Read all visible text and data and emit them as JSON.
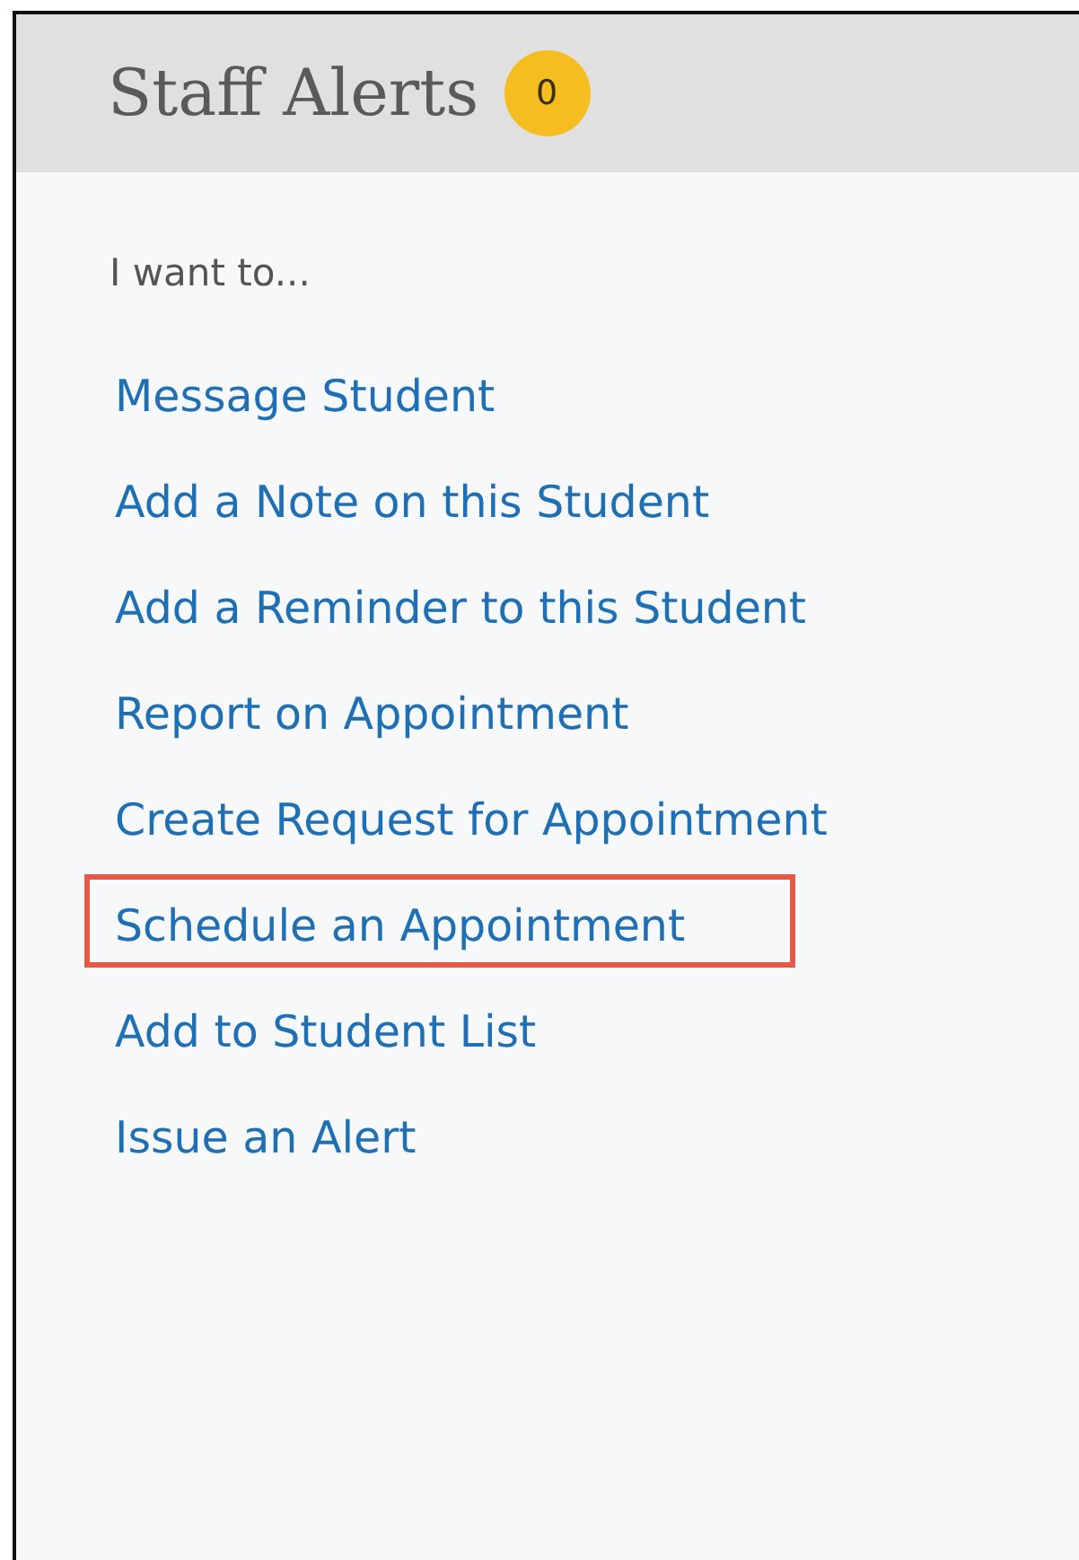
{
  "header": {
    "title": "Staff Alerts",
    "badge": "0"
  },
  "prompt": "I want to...",
  "actions": [
    {
      "label": "Message Student",
      "highlighted": false
    },
    {
      "label": "Add a Note on this Student",
      "highlighted": false
    },
    {
      "label": "Add a Reminder to this Student",
      "highlighted": false
    },
    {
      "label": "Report on Appointment",
      "highlighted": false
    },
    {
      "label": "Create Request for Appointment",
      "highlighted": false
    },
    {
      "label": "Schedule an Appointment",
      "highlighted": true
    },
    {
      "label": "Add to Student List",
      "highlighted": false
    },
    {
      "label": "Issue an Alert",
      "highlighted": false
    }
  ]
}
